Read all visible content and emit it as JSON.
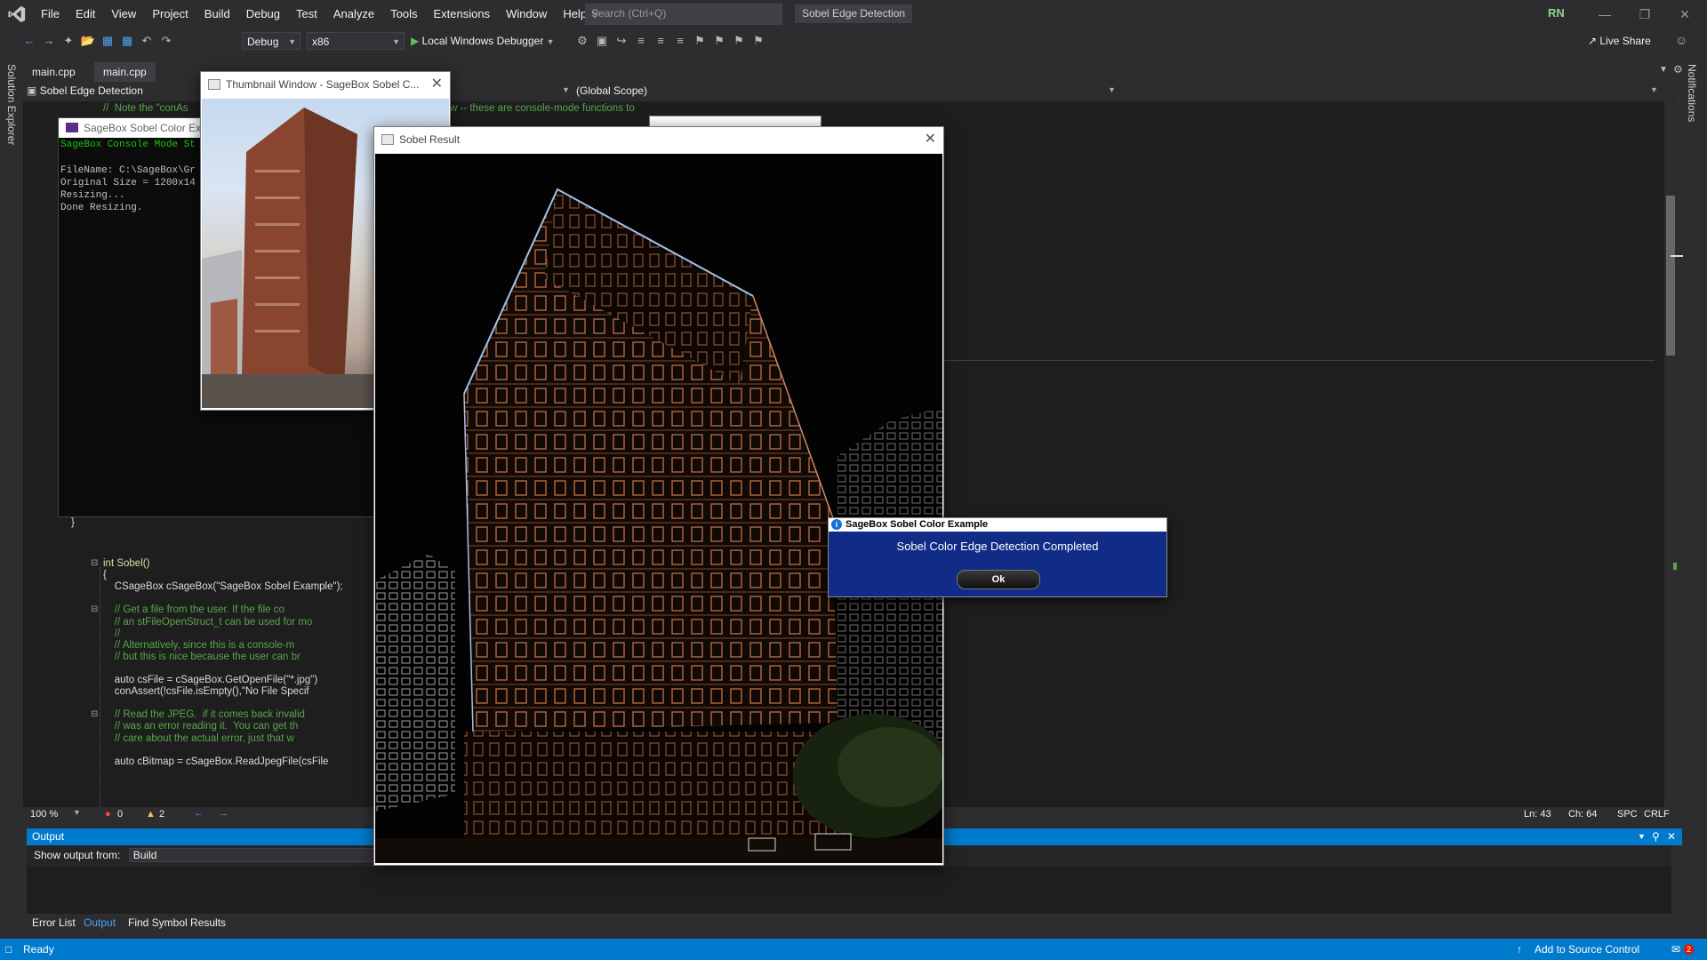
{
  "window": {
    "menu": [
      "File",
      "Edit",
      "View",
      "Project",
      "Build",
      "Debug",
      "Test",
      "Analyze",
      "Tools",
      "Extensions",
      "Window",
      "Help"
    ],
    "search_placeholder": "Search (Ctrl+Q)",
    "doc_title": "Sobel Edge Detection",
    "user_initials": "RN"
  },
  "toolbar": {
    "config": "Debug",
    "platform": "x86",
    "debugger": "Local Windows Debugger",
    "live_share": "Live Share"
  },
  "side": {
    "left_tab": "Solution Explorer",
    "right_tab": "Notifications"
  },
  "editor": {
    "tabs": [
      "main.cpp",
      "main.cpp"
    ],
    "nav_left": "Sobel Edge Detection",
    "nav_scope": "(Global Scope)",
    "top_comment_a": "//  Note the \"conAs",
    "top_comment_b": "w -- these are console-mode functions to",
    "closing_brace": "}",
    "lines": [
      {
        "text": "int Sobel()",
        "cls": "fn"
      },
      {
        "text": "{",
        "cls": "plain"
      },
      {
        "text": "    CSageBox cSageBox(\"SageBox Sobel Example\");",
        "cls": "plain"
      },
      {
        "text": "",
        "cls": "plain"
      },
      {
        "text": "    // Get a file from the user. If the file co",
        "cls": "cmt"
      },
      {
        "text": "    // an stFileOpenStruct_t can be used for mo",
        "cls": "cmt"
      },
      {
        "text": "    //",
        "cls": "cmt"
      },
      {
        "text": "    // Alternatively, since this is a console-m",
        "cls": "cmt"
      },
      {
        "text": "    // but this is nice because the user can br",
        "cls": "cmt"
      },
      {
        "text": "",
        "cls": "plain"
      },
      {
        "text": "    auto csFile = cSageBox.GetOpenFile(\"*.jpg\")",
        "cls": "plain"
      },
      {
        "text": "    conAssert(!csFile.isEmpty(),\"No File Specif",
        "cls": "plain"
      },
      {
        "text": "",
        "cls": "plain"
      },
      {
        "text": "    // Read the JPEG.  if it comes back invalid",
        "cls": "cmt"
      },
      {
        "text": "    // was an error reading it.  You can get th",
        "cls": "cmt"
      },
      {
        "text": "    // care about the actual error, just that w",
        "cls": "cmt"
      },
      {
        "text": "",
        "cls": "plain"
      },
      {
        "text": "    auto cBitmap = cSageBox.ReadJpegFile(csFile",
        "cls": "plain"
      }
    ],
    "zoom": "100 %",
    "errors": "0",
    "warnings": "2",
    "ln": "Ln: 43",
    "ch": "Ch: 64",
    "spc": "SPC",
    "crlf": "CRLF"
  },
  "output": {
    "title": "Output",
    "show_from_label": "Show output from:",
    "show_from_value": "Build"
  },
  "bottom_tabs": [
    "Error List",
    "Output",
    "Find Symbol Results"
  ],
  "statusbar": {
    "ready": "Ready",
    "source_control": "Add to Source Control",
    "notif_count": "2"
  },
  "console": {
    "title": "SageBox Sobel Color Exa",
    "heading": "SageBox Console Mode St",
    "lines": "FileName: C:\\SageBox\\Gr\nOriginal Size = 1200x14\nResizing...\nDone Resizing."
  },
  "thumbnail": {
    "title": "Thumbnail Window - SageBox Sobel C..."
  },
  "sobel": {
    "title": "Sobel Result"
  },
  "dialog": {
    "title": "SageBox Sobel Color Example",
    "message": "Sobel Color Edge Detection Completed",
    "ok": "Ok"
  },
  "colors": {
    "accent": "#007acc",
    "dialog_bg": "#102c86",
    "ide_bg": "#2d2d30",
    "editor_bg": "#1e1e1e"
  }
}
